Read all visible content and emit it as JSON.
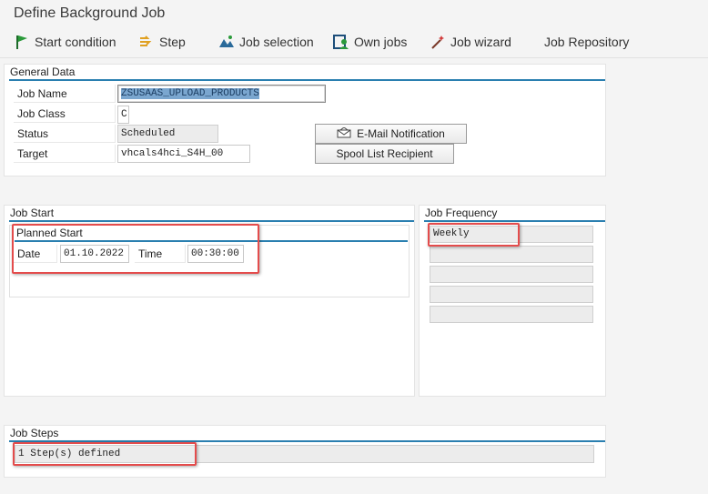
{
  "window": {
    "title": "Define Background Job"
  },
  "toolbar": {
    "start_condition": "Start condition",
    "step": "Step",
    "job_selection": "Job selection",
    "own_jobs": "Own jobs",
    "job_wizard": "Job wizard",
    "job_repository": "Job Repository"
  },
  "general_data": {
    "title": "General Data",
    "job_name_label": "Job Name",
    "job_name_value": "ZSUSAAS_UPLOAD_PRODUCTS",
    "job_class_label": "Job Class",
    "job_class_value": "C",
    "status_label": "Status",
    "status_value": "Scheduled",
    "target_label": "Target",
    "target_value": "vhcals4hci_S4H_00",
    "email_button": "E-Mail Notification",
    "spool_button": "Spool List Recipient"
  },
  "job_start": {
    "title": "Job Start",
    "planned_start_title": "Planned Start",
    "date_label": "Date",
    "date_value": "01.10.2022",
    "time_label": "Time",
    "time_value": "00:30:00"
  },
  "job_frequency": {
    "title": "Job Frequency",
    "rows": [
      "Weekly",
      "",
      "",
      "",
      ""
    ]
  },
  "job_steps": {
    "title": "Job Steps",
    "value": "1 Step(s) defined"
  },
  "colors": {
    "accent_line": "#2a7fb0",
    "highlight_box": "#e44c4c"
  }
}
